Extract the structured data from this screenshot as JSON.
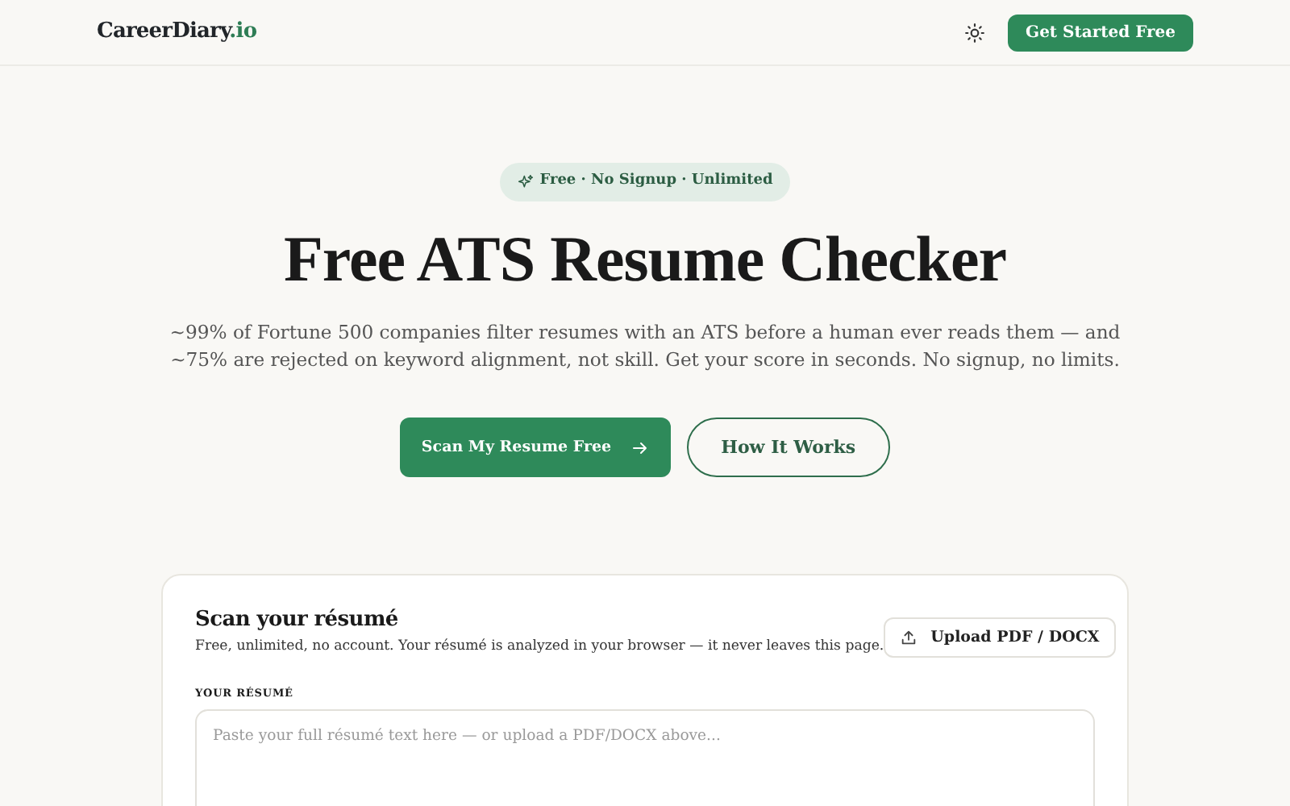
{
  "navbar": {
    "logo_main": "CareerDiary",
    "logo_suffix": ".io",
    "cta": "Get Started Free"
  },
  "hero": {
    "badge": "Free · No Signup · Unlimited",
    "title": "Free ATS Resume Checker",
    "description": "~99% of Fortune 500 companies filter resumes with an ATS before a human ever reads them — and ~75% are rejected on keyword alignment, not skill. Get your score in seconds. No signup, no limits.",
    "primary_button": "Scan My Resume Free",
    "secondary_button": "How It Works"
  },
  "scan_card": {
    "title": "Scan your résumé",
    "subtitle": "Free, unlimited, no account. Your résumé is analyzed in your browser — it never leaves this page.",
    "upload_button": "Upload PDF / DOCX",
    "field_label": "YOUR RÉSUMÉ",
    "placeholder": "Paste your full résumé text here — or upload a PDF/DOCX above..."
  }
}
